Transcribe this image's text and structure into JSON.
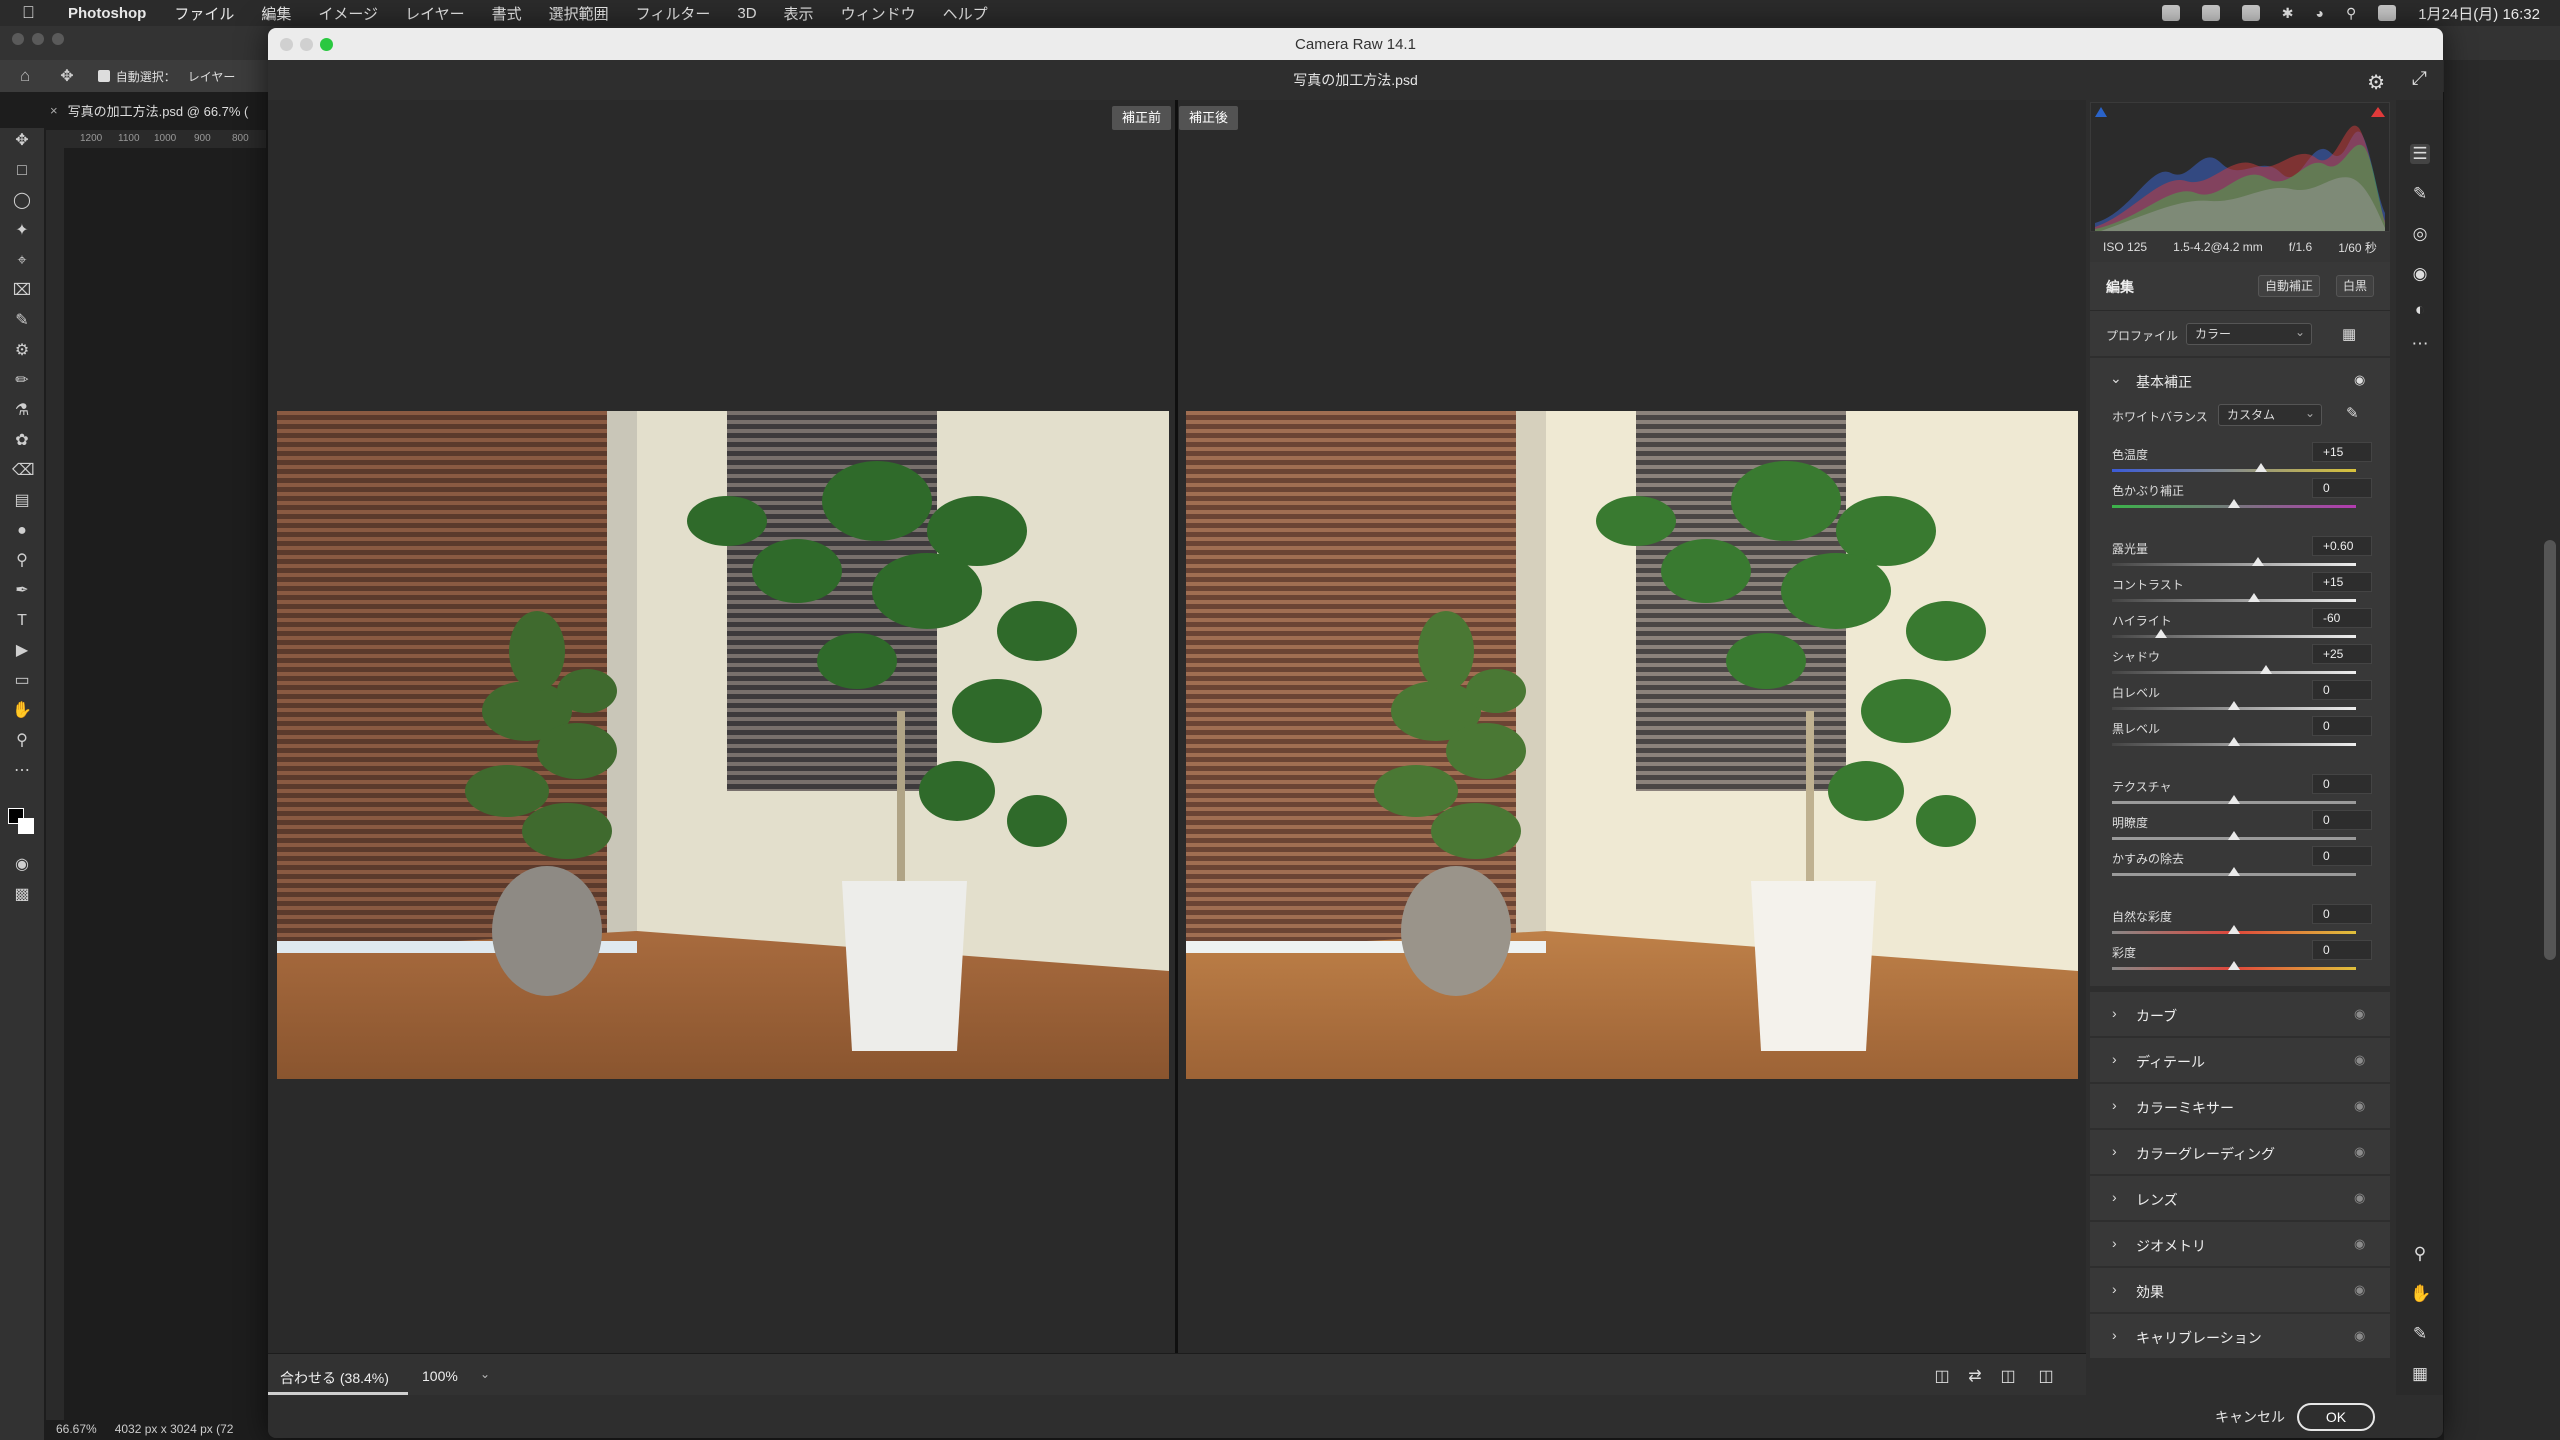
{
  "menubar": {
    "app_name": "Photoshop",
    "items": [
      "ファイル",
      "編集",
      "イメージ",
      "レイヤー",
      "書式",
      "選択範囲",
      "フィルター",
      "3D",
      "表示",
      "ウィンドウ",
      "ヘルプ"
    ],
    "clock": "1月24日(月) 16:32"
  },
  "ps": {
    "options_auto_select": "自動選択：",
    "options_layer": "レイヤー",
    "doc_tab": "写真の加工方法.psd @ 66.7% (",
    "ruler_ticks": [
      "1200",
      "1100",
      "1000",
      "900",
      "800"
    ],
    "status_zoom": "66.67%",
    "status_size": "4032 px x 3024 px (72"
  },
  "camera_raw": {
    "window_title": "Camera Raw 14.1",
    "file_name": "写真の加工方法.psd",
    "before_label": "補正前",
    "after_label": "補正後",
    "zoom_fit": "合わせる (38.4%)",
    "zoom_100": "100%",
    "cancel_label": "キャンセル",
    "ok_label": "OK"
  },
  "panel": {
    "exif": {
      "iso": "ISO 125",
      "lens": "1.5-4.2@4.2 mm",
      "aperture": "f/1.6",
      "shutter": "1/60 秒"
    },
    "edit_title": "編集",
    "auto_label": "自動補正",
    "bw_label": "白黒",
    "profile_label": "プロファイル",
    "profile_value": "カラー",
    "basic_title": "基本補正",
    "wb_label": "ホワイトバランス",
    "wb_value": "カスタム",
    "sliders": [
      {
        "label": "色温度",
        "value": "+15",
        "pos": 0.61
      },
      {
        "label": "色かぶり補正",
        "value": "0",
        "pos": 0.5
      },
      {
        "label": "露光量",
        "value": "+0.60",
        "pos": 0.6
      },
      {
        "label": "コントラスト",
        "value": "+15",
        "pos": 0.58
      },
      {
        "label": "ハイライト",
        "value": "-60",
        "pos": 0.2
      },
      {
        "label": "シャドウ",
        "value": "+25",
        "pos": 0.63
      },
      {
        "label": "白レベル",
        "value": "0",
        "pos": 0.5
      },
      {
        "label": "黒レベル",
        "value": "0",
        "pos": 0.5
      },
      {
        "label": "テクスチャ",
        "value": "0",
        "pos": 0.5
      },
      {
        "label": "明瞭度",
        "value": "0",
        "pos": 0.5
      },
      {
        "label": "かすみの除去",
        "value": "0",
        "pos": 0.5
      },
      {
        "label": "自然な彩度",
        "value": "0",
        "pos": 0.5
      },
      {
        "label": "彩度",
        "value": "0",
        "pos": 0.5
      }
    ],
    "sections": [
      "カーブ",
      "ディテール",
      "カラーミキサー",
      "カラーグレーディング",
      "レンズ",
      "ジオメトリ",
      "効果",
      "キャリブレーション"
    ]
  },
  "colors": {
    "temp_gradient": [
      "#3b5bd8",
      "#d8c23b"
    ],
    "tint_gradient": [
      "#3bb34a",
      "#b33bb0"
    ],
    "saturation_gradient": [
      "#888888",
      "#e0473b"
    ]
  }
}
